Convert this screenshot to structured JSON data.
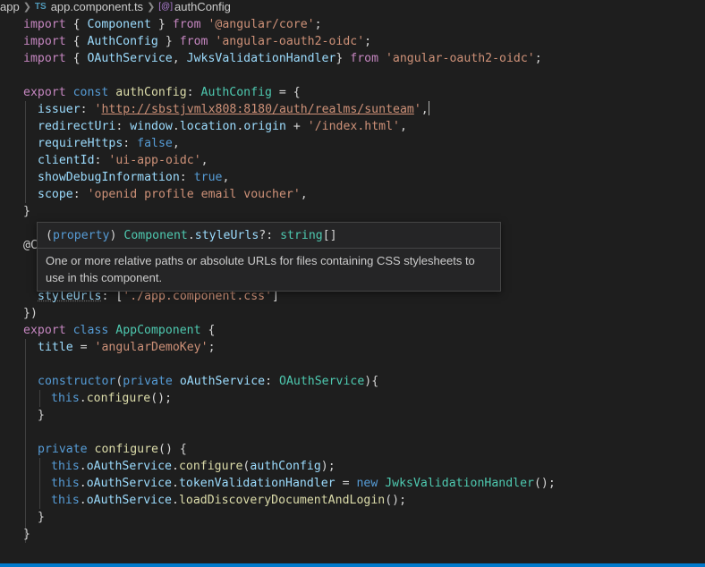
{
  "breadcrumb": {
    "folder": "app",
    "file_badge": "TS",
    "file": "app.component.ts",
    "symbol_badge": "[@]",
    "symbol": "authConfig"
  },
  "code": {
    "l1": {
      "kw": "import",
      "a": " { ",
      "b": "Component",
      "c": " } ",
      "d": "from",
      "e": " ",
      "f": "'@angular/core'",
      "g": ";"
    },
    "l2": {
      "kw": "import",
      "a": " { ",
      "b": "AuthConfig",
      "c": " } ",
      "d": "from",
      "e": " ",
      "f": "'angular-oauth2-oidc'",
      "g": ";"
    },
    "l3": {
      "kw": "import",
      "a": " { ",
      "b": "OAuthService",
      "c": ", ",
      "d": "JwksValidationHandler",
      "e": "} ",
      "f": "from",
      "g": " ",
      "h": "'angular-oauth2-oidc'",
      "i": ";"
    },
    "l5": {
      "a": "export",
      "b": " ",
      "c": "const",
      "d": " ",
      "e": "authConfig",
      "f": ": ",
      "g": "AuthConfig",
      "h": " = {"
    },
    "l6": {
      "a": "issuer",
      "b": ": ",
      "q1": "'",
      "url": "http://sbstjvmlx808:8180/auth/realms/sunteam",
      "q2": "'",
      "c": ","
    },
    "l7": {
      "a": "redirectUri",
      "b": ": ",
      "c": "window",
      "d": ".",
      "e": "location",
      "f": ".",
      "g": "origin",
      "h": " + ",
      "i": "'/index.html'",
      "j": ","
    },
    "l8": {
      "a": "requireHttps",
      "b": ": ",
      "c": "false",
      "d": ","
    },
    "l9": {
      "a": "clientId",
      "b": ": ",
      "c": "'ui-app-oidc'",
      "d": ","
    },
    "l10": {
      "a": "showDebugInformation",
      "b": ": ",
      "c": "true",
      "d": ","
    },
    "l11": {
      "a": "scope",
      "b": ": ",
      "c": "'openid profile email voucher'",
      "d": ","
    },
    "l12": {
      "a": "}"
    },
    "l14": {
      "a": "@C"
    },
    "l17": {
      "a": "styleUrls",
      "b": ": [",
      "c": "'./app.component.css'",
      "d": "]"
    },
    "l18": {
      "a": "})"
    },
    "l19": {
      "a": "export",
      "b": " ",
      "c": "class",
      "d": " ",
      "e": "AppComponent",
      "f": " {"
    },
    "l20": {
      "a": "title",
      "b": " = ",
      "c": "'angularDemoKey'",
      "d": ";"
    },
    "l22": {
      "a": "constructor",
      "b": "(",
      "c": "private",
      "d": " ",
      "e": "oAuthService",
      "f": ": ",
      "g": "OAuthService",
      "h": "){"
    },
    "l23": {
      "a": "this",
      "b": ".",
      "c": "configure",
      "d": "();"
    },
    "l24": {
      "a": "}"
    },
    "l26": {
      "a": "private",
      "b": " ",
      "c": "configure",
      "d": "() {"
    },
    "l27": {
      "a": "this",
      "b": ".",
      "c": "oAuthService",
      "d": ".",
      "e": "configure",
      "f": "(",
      "g": "authConfig",
      "h": ");"
    },
    "l28": {
      "a": "this",
      "b": ".",
      "c": "oAuthService",
      "d": ".",
      "e": "tokenValidationHandler",
      "f": " = ",
      "g": "new",
      "h": " ",
      "i": "JwksValidationHandler",
      "j": "();"
    },
    "l29": {
      "a": "this",
      "b": ".",
      "c": "oAuthService",
      "d": ".",
      "e": "loadDiscoveryDocumentAndLogin",
      "f": "();"
    },
    "l30": {
      "a": "}"
    },
    "l31": {
      "a": "}"
    }
  },
  "hover": {
    "sig_open": "(",
    "sig_kind": "property",
    "sig_close": ") ",
    "sig_class": "Component",
    "sig_dot": ".",
    "sig_prop": "styleUrls",
    "sig_rest": "?: ",
    "sig_type": "string",
    "sig_arr": "[]",
    "doc": "One or more relative paths or absolute URLs for files containing CSS stylesheets to use in this component."
  },
  "colors": {
    "background": "#1e1e1e",
    "keyword": "#569cd6",
    "control_keyword": "#c586c0",
    "string": "#ce9178",
    "property": "#9cdcfe",
    "type": "#4ec9b0",
    "function": "#dcdcaa",
    "accent": "#007acc"
  }
}
